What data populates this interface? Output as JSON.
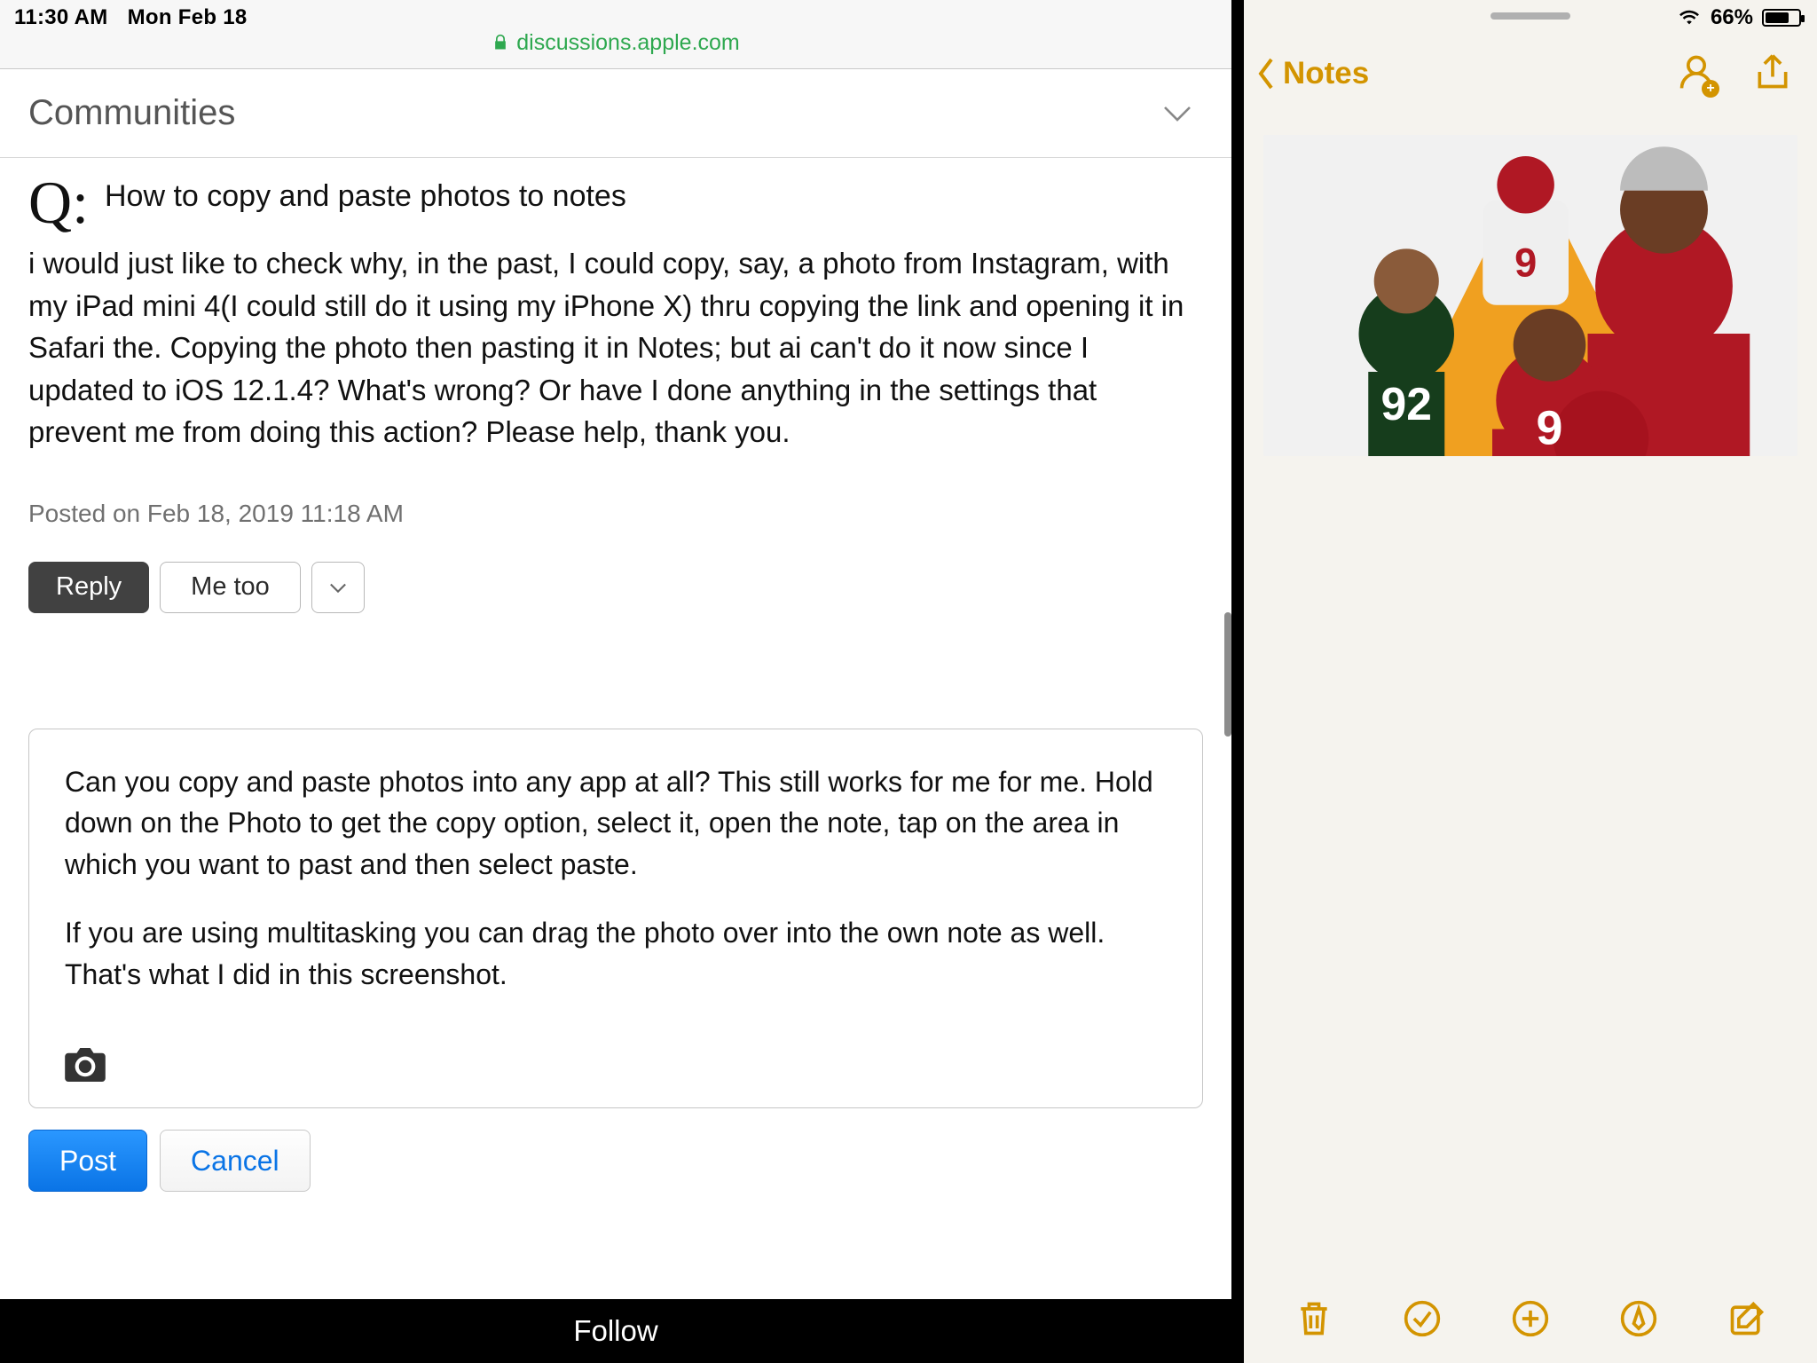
{
  "statusbar_left": {
    "time": "11:30 AM",
    "date": "Mon Feb 18"
  },
  "statusbar_right": {
    "battery": "66%"
  },
  "safari": {
    "url_host": "discussions.apple.com"
  },
  "communities": {
    "label": "Communities"
  },
  "question": {
    "qmark": "Q:",
    "title": "How to copy and paste photos to notes",
    "body": "i would just like to check why, in the past, I could copy, say, a photo from Instagram, with my iPad mini 4(I could still do it using my iPhone X) thru copying the link and opening it in Safari the. Copying the photo then pasting it in Notes; but ai can't do it now since I updated to iOS 12.1.4? What's wrong? Or have I done anything in the settings that prevent me from doing this action? Please help, thank you.",
    "posted": "Posted on Feb 18, 2019 11:18 AM"
  },
  "buttons": {
    "reply": "Reply",
    "metoo": "Me too"
  },
  "reply": {
    "p1": "Can you copy and paste photos into any app at all? This still works for me for me. Hold down on the Photo to get the copy option, select it, open the note, tap on the area in which you want to past and then select paste.",
    "p2": "If you are using multitasking you can drag the photo over into the own note as well. That's what I did in this screenshot."
  },
  "post_actions": {
    "post": "Post",
    "cancel": "Cancel"
  },
  "follow": {
    "label": "Follow"
  },
  "notes_nav": {
    "back": "Notes"
  }
}
